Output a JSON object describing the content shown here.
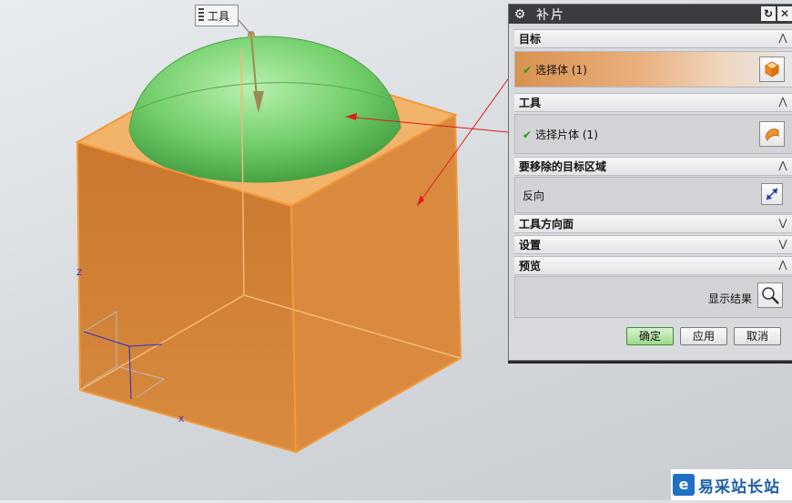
{
  "toolbar_tag": {
    "label": "工具"
  },
  "viewport": {
    "icons": [
      "grip-icon"
    ],
    "axis_labels": {
      "z": "Z",
      "x": "X"
    }
  },
  "dialog": {
    "title": "补片",
    "title_buttons": [
      "reset-icon",
      "close-icon"
    ],
    "sections": {
      "target": {
        "label": "目标",
        "select_text": "选择体 (1)"
      },
      "tool": {
        "label": "工具",
        "select_text": "选择片体 (1)"
      },
      "remove_region": {
        "label": "要移除的目标区域",
        "reverse_text": "反向"
      },
      "tool_direction": {
        "label": "工具方向面"
      },
      "settings": {
        "label": "设置"
      },
      "preview": {
        "label": "预览",
        "show_result": "显示结果"
      }
    },
    "buttons": {
      "ok": "确定",
      "apply": "应用",
      "cancel": "取消"
    }
  },
  "colors": {
    "accent_green": "#1aa21a",
    "body_orange": "#e08a35",
    "dome_green": "#7fd57a"
  },
  "watermark": {
    "text": "易采站长站"
  }
}
